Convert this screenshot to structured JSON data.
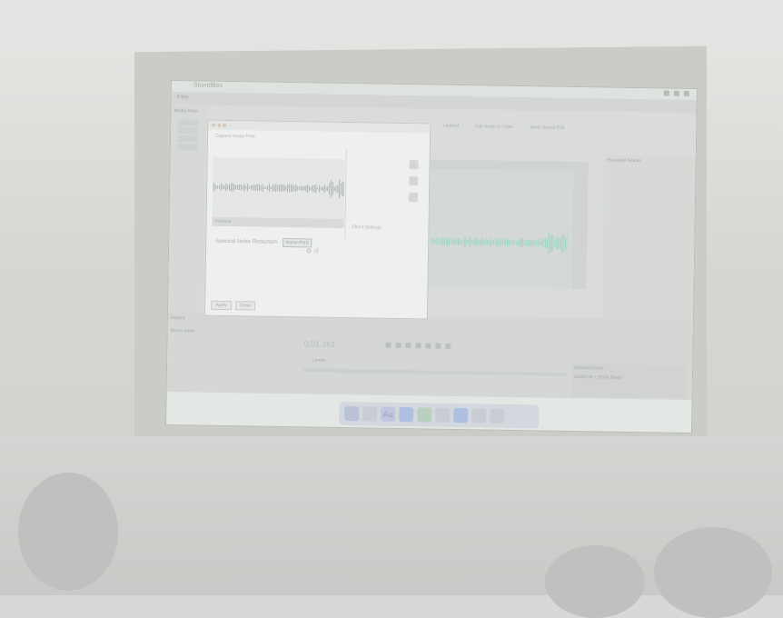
{
  "colors": {
    "waveform": "#9fd7c3",
    "time_display": "#b9bdc4",
    "dialog_wave": "#a4a8a4"
  },
  "mac_menu_bar": {
    "app_name": "SoundBox"
  },
  "app": {
    "toolbar": {
      "files_label": "Files",
      "media_browser_label": "Media Brow"
    },
    "tabs": [
      "Untitled",
      "Edit Audio to Video",
      "Basic Sound Edit"
    ],
    "right_panel": {
      "title": "Essential Sound"
    },
    "bottom": {
      "history_label": "History",
      "track_label": "Demo Audio",
      "time_display": "0:01.261",
      "levels_label": "Levels",
      "selection_view_label": "Selection/View",
      "status_text": "44100 Hz • 32-bit (float)"
    }
  },
  "dialog": {
    "header": "Capture Noise Print",
    "preview_label": "Preview",
    "right_label": "Effect Settings",
    "row_text": "Spectral Noise Reduction",
    "inline_button": "Noise Print",
    "footer_buttons": [
      "Apply",
      "Close"
    ]
  },
  "dock": {
    "icons": [
      "finder-icon",
      "no-entry-icon",
      "audition-icon",
      "safari-icon",
      "app-icon",
      "file-icon",
      "folder-icon",
      "display-icon",
      "trash-icon"
    ],
    "audition_glyph": "Au"
  }
}
